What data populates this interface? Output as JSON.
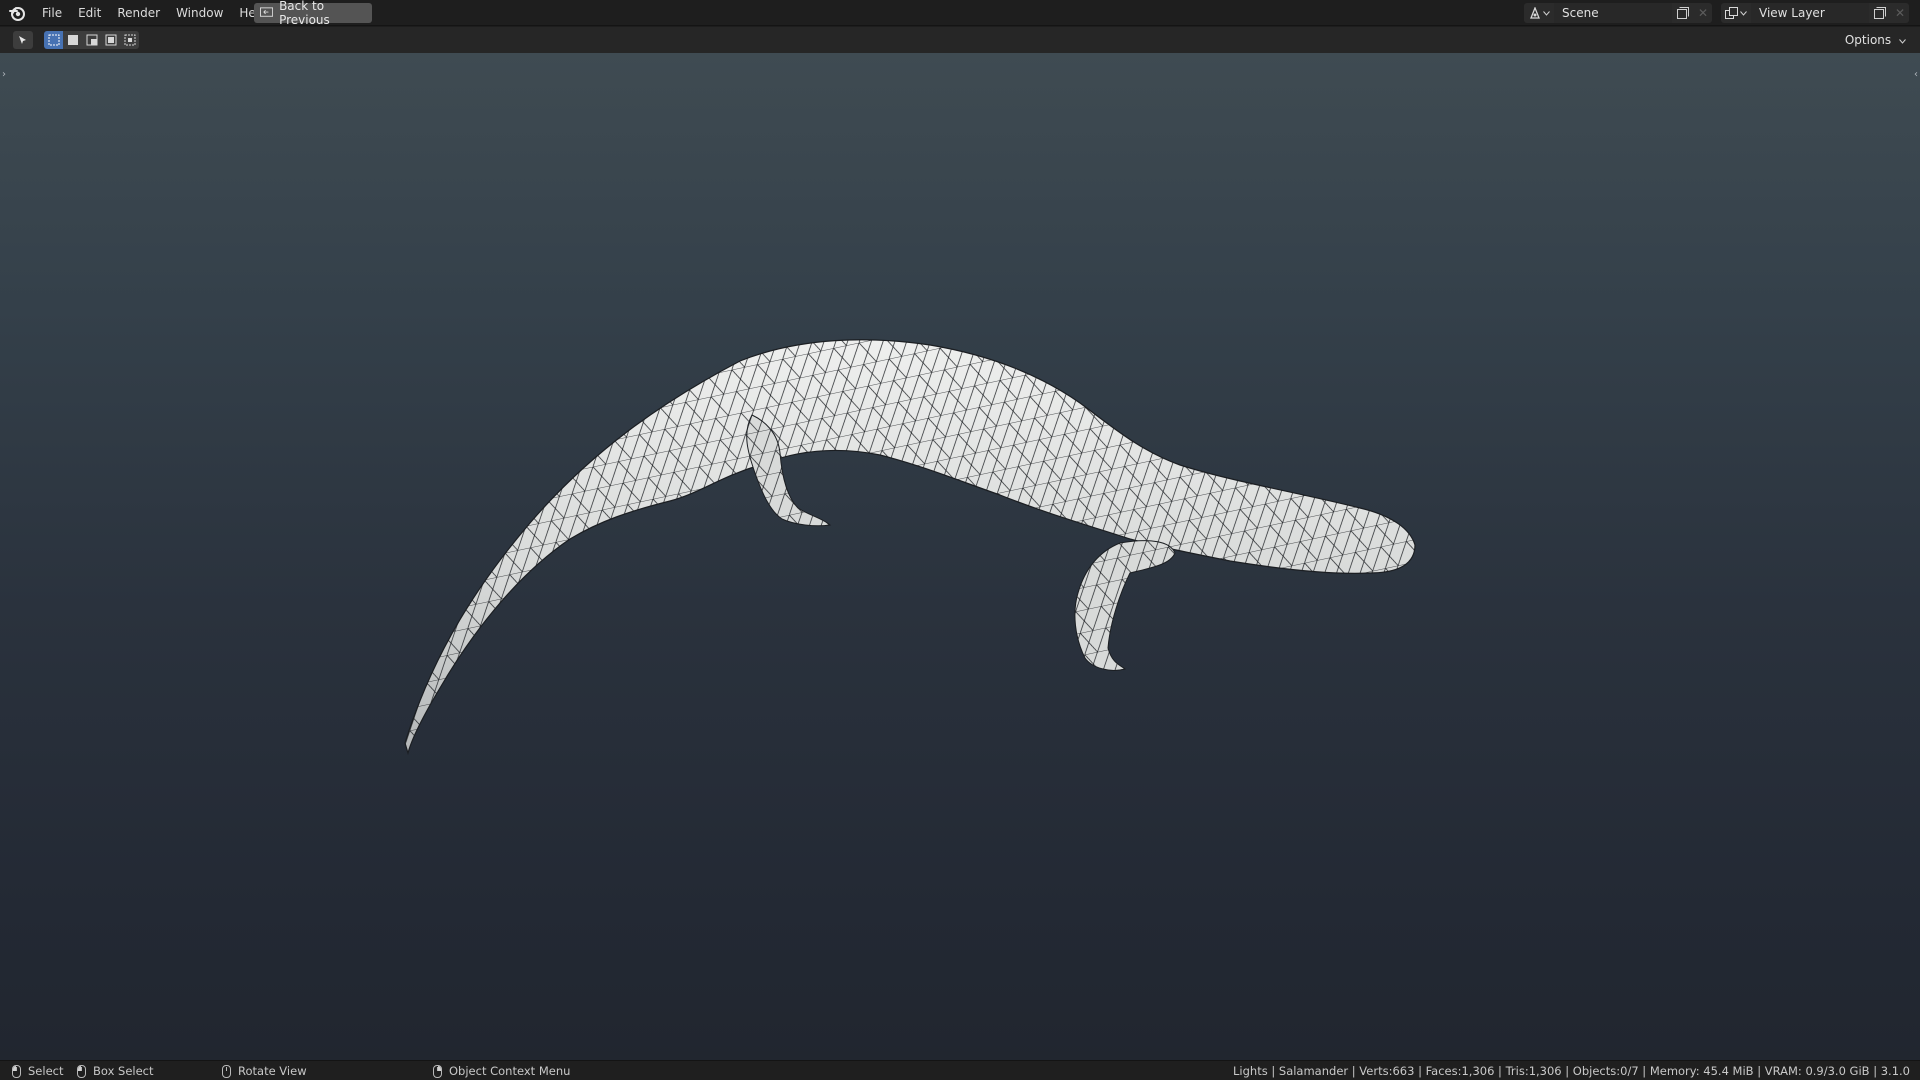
{
  "menu": {
    "items": [
      "File",
      "Edit",
      "Render",
      "Window",
      "Help"
    ],
    "back_button": "Back to Previous"
  },
  "scene": {
    "name": "Scene"
  },
  "view_layer": {
    "name": "View Layer"
  },
  "viewport_header": {
    "options_label": "Options"
  },
  "status": {
    "select": "Select",
    "box_select": "Box Select",
    "rotate_view": "Rotate View",
    "context_menu": "Object Context Menu",
    "stats": "Lights | Salamander | Verts:663 | Faces:1,306 | Tris:1,306 | Objects:0/7 | Memory: 45.4 MiB | VRAM: 0.9/3.0 GiB | 3.1.0"
  },
  "icons": {
    "logo": "blender-logo-icon",
    "back": "back-to-previous-icon",
    "scene": "scene-icon",
    "view_layer": "view-layer-icon",
    "mode": "select-mode-icon"
  },
  "colors": {
    "accent": "#4772b3",
    "mesh_fill": "#e2e4e2",
    "mesh_wire": "#1b1e22"
  }
}
